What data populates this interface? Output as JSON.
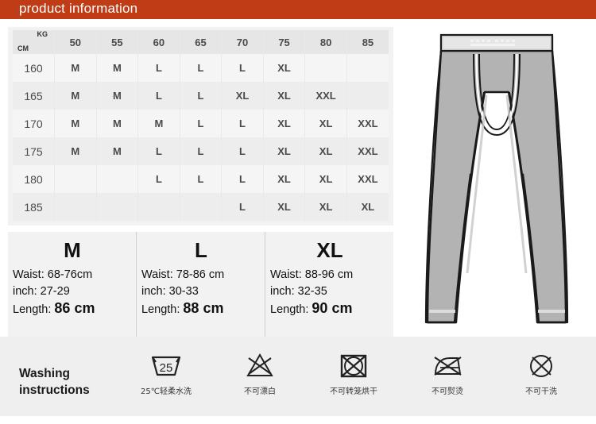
{
  "banner": {
    "title": "product information"
  },
  "size_table": {
    "corner": {
      "kg": "KG",
      "cm": "CM"
    },
    "columns": [
      "50",
      "55",
      "60",
      "65",
      "70",
      "75",
      "80",
      "85"
    ],
    "rows": [
      {
        "height": "160",
        "cells": [
          "M",
          "M",
          "L",
          "L",
          "L",
          "XL",
          "",
          ""
        ]
      },
      {
        "height": "165",
        "cells": [
          "M",
          "M",
          "L",
          "L",
          "XL",
          "XL",
          "XXL",
          ""
        ]
      },
      {
        "height": "170",
        "cells": [
          "M",
          "M",
          "M",
          "L",
          "L",
          "XL",
          "XL",
          "XXL"
        ]
      },
      {
        "height": "175",
        "cells": [
          "M",
          "M",
          "L",
          "L",
          "L",
          "XL",
          "XL",
          "XXL"
        ]
      },
      {
        "height": "180",
        "cells": [
          "",
          "",
          "L",
          "L",
          "L",
          "XL",
          "XL",
          "XXL"
        ]
      },
      {
        "height": "185",
        "cells": [
          "",
          "",
          "",
          "",
          "L",
          "XL",
          "XL",
          "XL"
        ]
      }
    ]
  },
  "size_details": [
    {
      "letter": "M",
      "waist_label": "Waist:",
      "waist_value": "68-76cm",
      "inch_label": "inch:",
      "inch_value": "27-29",
      "length_label": "Length:",
      "length_value": "86 cm"
    },
    {
      "letter": "L",
      "waist_label": "Waist:",
      "waist_value": "78-86 cm",
      "inch_label": "inch:",
      "inch_value": "30-33",
      "length_label": "Length:",
      "length_value": "88 cm"
    },
    {
      "letter": "XL",
      "waist_label": "Waist:",
      "waist_value": "88-96 cm",
      "inch_label": "inch:",
      "inch_value": "32-35",
      "length_label": "Length:",
      "length_value": "90 cm"
    }
  ],
  "washing": {
    "title_line1": "Washing",
    "title_line2": "instructions",
    "items": [
      {
        "icon": "wash-tub-25-icon",
        "temperature": "25",
        "label": "25℃轻柔水洗"
      },
      {
        "icon": "no-bleach-icon",
        "label": "不可漂白"
      },
      {
        "icon": "no-tumble-dry-icon",
        "label": "不可转笼烘干"
      },
      {
        "icon": "no-iron-icon",
        "label": "不可熨烫"
      },
      {
        "icon": "no-dry-clean-icon",
        "label": "不可干洗"
      }
    ]
  },
  "product_image": {
    "name": "long-johns-illustration"
  },
  "colors": {
    "banner": "#bf3c16",
    "panel_bg": "#f2f2f2",
    "row_odd": "#ededed",
    "row_even": "#f5f5f5",
    "header_row": "#e6e6e6",
    "garment_fill": "#b3b3b3",
    "garment_stroke": "#1a1a1a"
  }
}
